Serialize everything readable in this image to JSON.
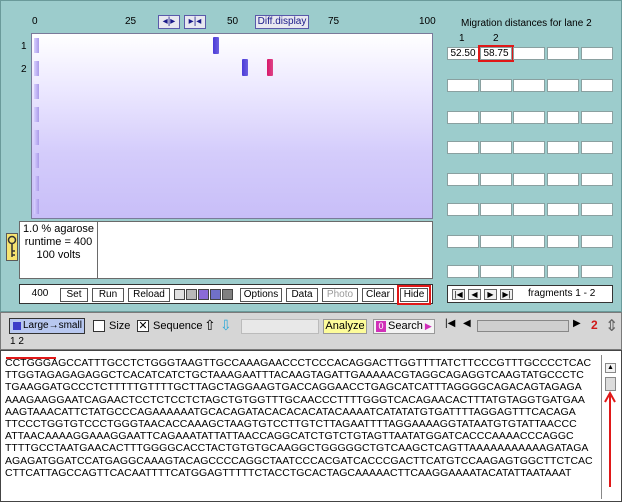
{
  "ruler": {
    "ticks": [
      "0",
      "25",
      "50",
      "75",
      "100"
    ]
  },
  "tools": {
    "expand_label": "◂|▸",
    "collapse_label": "▸|◂",
    "diff_display_label": "Diff.display"
  },
  "lanes": [
    "1",
    "2"
  ],
  "gel_bands": [
    {
      "lane": 1,
      "position": 45,
      "color": "#4a3ad8"
    },
    {
      "lane": 2,
      "position": 52.5,
      "color": "#4a3ad8"
    },
    {
      "lane": 2,
      "position": 58.75,
      "color": "#d8186a"
    }
  ],
  "gel_info": {
    "agarose": "1.0 % agarose",
    "runtime": "runtime = 400",
    "volts": "100 volts"
  },
  "toolbar": {
    "value": "400",
    "set": "Set",
    "run": "Run",
    "reload": "Reload",
    "options": "Options",
    "data": "Data",
    "photo": "Photo",
    "clear": "Clear",
    "hide": "Hide"
  },
  "swatch_colors": [
    "#e0e0e0",
    "#b8b8b8",
    "#8a6ad8",
    "#7070c8",
    "#808080"
  ],
  "migration": {
    "title": "Migration distances for lane 2",
    "col_headers": [
      "1",
      "2"
    ],
    "values": [
      "52.50",
      "58.75"
    ]
  },
  "nav": {
    "fragments_label": "fragments 1 - 2"
  },
  "midbar": {
    "large_small": "Large→small",
    "size": "Size",
    "sequence": "Sequence",
    "analyze": "Analyze",
    "search": "Search",
    "search_prefix": "0",
    "count": "2",
    "row_numbers": "1  2"
  },
  "sequence": {
    "lines": [
      "CCTGGGAGCCATTTGCCTCTGGGTAAGTTGCCAAAGAACCCTCCCACAGGACTTGGTTTTATCTTCCCGTTTGCCCCTCAC",
      "TTGGTAGAGAGAGGCTCACATCATCTGCTAAAGAATTTACAAGTAGATTGAAAAACGTAGGCAGAGGTCAAGTATGCCCTC",
      "TGAAGGATGCCCTCTTTTTGTTTTGCTTAGCTAGGAAGTGACCAGGAACCTGAGCATCATTTAGGGGCAGACAGTAGAGA",
      "AAAGAAGGAATCAGAACTCCTCTCCTCTAGCTGTGGTTTGCAACCCTTTTGGGTCACAGAACACTTTATGTAGGTGATGAA",
      "AAGTAAACATTCTATGCCCAGAAAAAATGCACAGATACACACACATACAAAATCATATATGTGATTTTAGGAGTTTCACAGA",
      "TTCCCTGGTGTCCCTGGGTAACACCAAAGCTAAGTGTCCTTGTCTTAGAATTTTAGGAAAAGGTATAATGTGTATTAACCC",
      "ATTAACAAAAGGAAAGGAATTCAGAAATATTATTAACCAGGCATCTGTCTGTAGTTAATATGGATCACCCAAAACCCAGGC",
      "TTTTGCCTAATGAACACTTTGGGGCACCTACTGTGTGCAAGGCTGGGGGCTGTCAAGCTCAGTTAAAAAAAAAAAGATAGA",
      "AGAGATGGATCCATGAGGCAAAGTACAGCCCCAGGCTAATCCCACGATCACCCGACTTCATGTCCAAGAGTGGCTTCTCAC",
      "CTTCATTAGCCAGTTCACAATTTTCATGGAGTTTTTCTACCTGCACTAGCAAAAACTTCAAGGAAAATACATATTAATAAAT"
    ]
  }
}
